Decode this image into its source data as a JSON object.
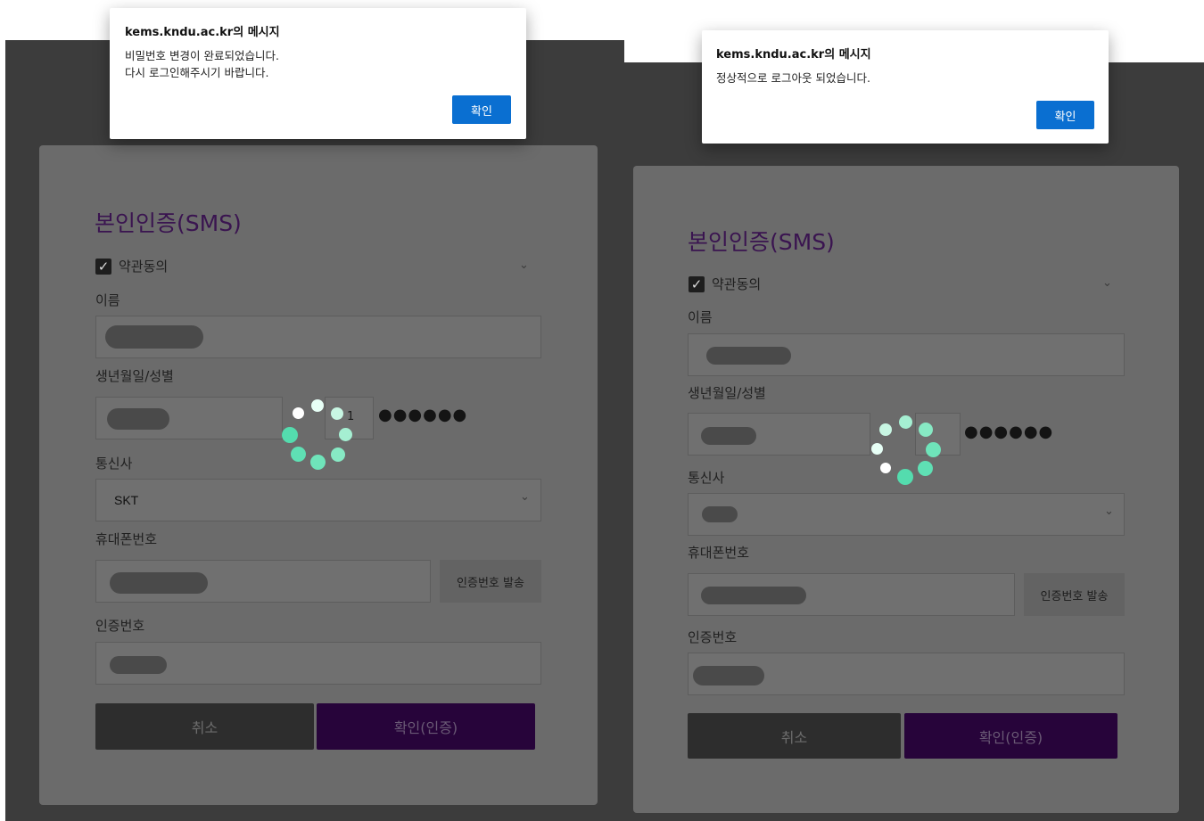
{
  "left": {
    "dialog": {
      "title": "kems.kndu.ac.kr의 메시지",
      "message": "비밀번호 변경이 완료되었습니다.\n다시 로그인해주시기 바랍니다.",
      "ok_label": "확인"
    },
    "form": {
      "title": "본인인증(SMS)",
      "agree_label": "약관동의",
      "name_label": "이름",
      "birth_label": "생년월일/성별",
      "gender_digit": "1",
      "birth_mask": "●●●●●●",
      "carrier_label": "통신사",
      "carrier_value": "SKT",
      "phone_label": "휴대폰번호",
      "send_code_label": "인증번호 발송",
      "code_label": "인증번호",
      "cancel_label": "취소",
      "confirm_label": "확인(인증)"
    }
  },
  "right": {
    "dialog": {
      "title": "kems.kndu.ac.kr의 메시지",
      "message": "정상적으로 로그아웃 되었습니다.",
      "ok_label": "확인"
    },
    "form": {
      "title": "본인인증(SMS)",
      "agree_label": "약관동의",
      "name_label": "이름",
      "birth_label": "생년월일/성별",
      "birth_mask": "●●●●●●",
      "carrier_label": "통신사",
      "phone_label": "휴대폰번호",
      "send_code_label": "인증번호 발송",
      "code_label": "인증번호",
      "cancel_label": "취소",
      "confirm_label": "확인(인증)"
    }
  },
  "icons": {
    "checkbox": "check-icon",
    "chevron": "chevron-down-icon",
    "spinner": "loading-spinner-icon"
  },
  "colors": {
    "accent": "#27043a",
    "ok_button": "#0a6fd1",
    "overlay": "#3c3c3c",
    "spinner": "#5fe0b4"
  }
}
